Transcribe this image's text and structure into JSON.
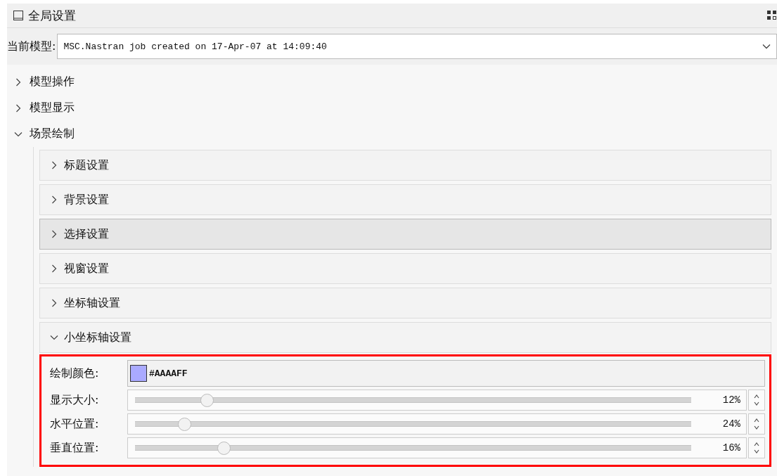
{
  "window": {
    "title": "全局设置"
  },
  "model": {
    "label": "当前模型:",
    "value": "MSC.Nastran job created on 17-Apr-07 at 14:09:40"
  },
  "tree": [
    {
      "label": "模型操作",
      "expanded": false
    },
    {
      "label": "模型显示",
      "expanded": false
    },
    {
      "label": "场景绘制",
      "expanded": true,
      "children": [
        {
          "label": "标题设置",
          "expanded": false,
          "selected": false
        },
        {
          "label": "背景设置",
          "expanded": false,
          "selected": false
        },
        {
          "label": "选择设置",
          "expanded": false,
          "selected": true
        },
        {
          "label": "视窗设置",
          "expanded": false,
          "selected": false
        },
        {
          "label": "坐标轴设置",
          "expanded": false,
          "selected": false
        },
        {
          "label": "小坐标轴设置",
          "expanded": true,
          "selected": false,
          "highlighted": true,
          "fields": [
            {
              "kind": "color",
              "label": "绘制颜色:",
              "value": "#AAAAFF",
              "color": "#aaaaff"
            },
            {
              "kind": "slider",
              "label": "显示大小:",
              "level": 0.13,
              "reading": "12%"
            },
            {
              "kind": "slider",
              "label": "水平位置:",
              "level": 0.09,
              "reading": "24%"
            },
            {
              "kind": "slider",
              "label": "垂直位置:",
              "level": 0.16,
              "reading": "16%"
            }
          ]
        }
      ]
    }
  ]
}
